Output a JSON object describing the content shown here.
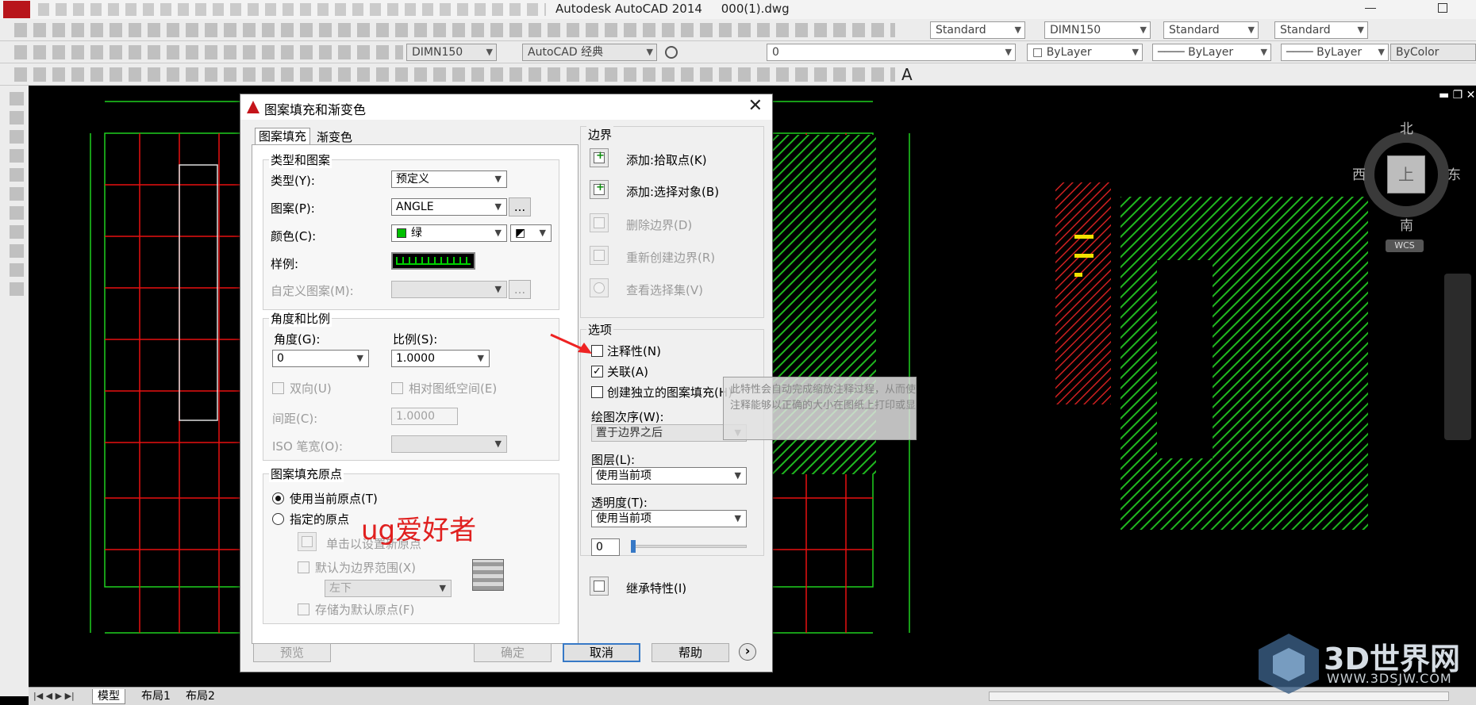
{
  "window": {
    "app_title": "Autodesk AutoCAD 2014",
    "file_name": "000(1).dwg"
  },
  "toolbar1": {
    "text_style": "Standard",
    "dim_style": "DIMN150",
    "table_style": "Standard",
    "mleader_style": "Standard"
  },
  "toolbar2": {
    "dim_style": "DIMN150",
    "workspace": "AutoCAD 经典",
    "layer": "0",
    "color": "ByLayer",
    "linetype": "ByLayer",
    "lineweight": "ByLayer",
    "plotstyle": "ByColor"
  },
  "toolbar3": {
    "text_icon": "A"
  },
  "tabs": [
    "模型",
    "布局1",
    "布局2"
  ],
  "compass": {
    "north": "北",
    "south": "南",
    "east": "东",
    "west": "西",
    "top": "上",
    "wcs": "WCS"
  },
  "dialog": {
    "title": "图案填充和渐变色",
    "tab_hatch": "图案填充",
    "tab_gradient": "渐变色",
    "type_group": "类型和图案",
    "type_label": "类型(Y):",
    "type_value": "预定义",
    "pattern_label": "图案(P):",
    "pattern_value": "ANGLE",
    "pattern_btn": "...",
    "color_label": "颜色(C):",
    "color_value": "绿",
    "color_swatch": "#00c000",
    "sample_label": "样例:",
    "custom_label": "自定义图案(M):",
    "custom_btn": "...",
    "angle_group": "角度和比例",
    "angle_label": "角度(G):",
    "angle_value": "0",
    "scale_label": "比例(S):",
    "scale_value": "1.0000",
    "double_label": "双向(U)",
    "relative_label": "相对图纸空间(E)",
    "spacing_label": "间距(C):",
    "spacing_value": "1.0000",
    "iso_label": "ISO 笔宽(O):",
    "origin_group": "图案填充原点",
    "origin_current": "使用当前原点(T)",
    "origin_specified": "指定的原点",
    "origin_click": "单击以设置新原点",
    "origin_default_bounds": "默认为边界范围(X)",
    "origin_position": "左下",
    "origin_store": "存储为默认原点(F)",
    "watermark": "ug爱好者",
    "boundary_group": "边界",
    "add_pick": "添加:拾取点(K)",
    "add_select": "添加:选择对象(B)",
    "remove_boundary": "删除边界(D)",
    "recreate_boundary": "重新创建边界(R)",
    "view_selection": "查看选择集(V)",
    "options_group": "选项",
    "annotative_label": "注释性(N)",
    "associative_label": "关联(A)",
    "separate_label": "创建独立的图案填充(H)",
    "draw_order_label": "绘图次序(W):",
    "draw_order_value": "置于边界之后",
    "layer_label": "图层(L):",
    "layer_value": "使用当前项",
    "transparency_label": "透明度(T):",
    "transparency_value": "使用当前项",
    "transparency_number": "0",
    "inherit_label": "继承特性(I)",
    "tooltip_line1": "此特性会自动完成缩放注释过程，从而使",
    "tooltip_line2": "注释能够以正确的大小在图纸上打印或显示 (HPANNOTATIVE",
    "preview_btn": "预览",
    "ok_btn": "确定",
    "cancel_btn": "取消",
    "help_btn": "帮助",
    "more_btn": "›"
  },
  "brand": {
    "name": "3D世界网",
    "url": "WWW.3DSJW.COM"
  }
}
